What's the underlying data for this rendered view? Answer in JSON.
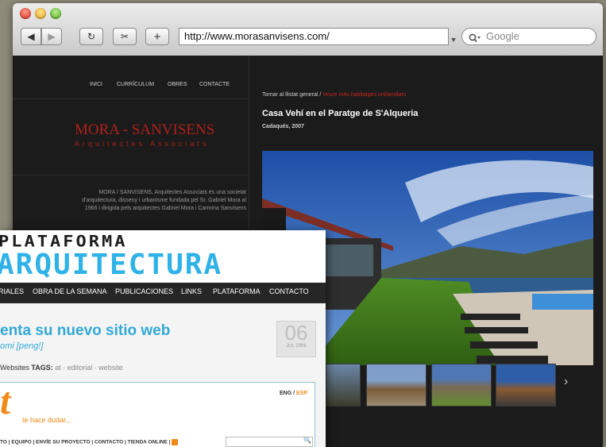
{
  "browser": {
    "url": "http://www.morasanvisens.com/",
    "search_placeholder": "Google",
    "buttons": {
      "back": "◀",
      "forward": "▶",
      "reload": "↻",
      "snip": "✂",
      "add": "+"
    }
  },
  "site": {
    "nav": [
      "INICI",
      "CURRÍCULUM",
      "OBRES",
      "CONTACTE"
    ],
    "brand": "MORA - SANVISENS",
    "brand_sub": "Arquitectes Associats",
    "intro": "MORA / SANVISENS, Arquitectes Associats és una societat d'arquitectura, disseny i urbanisme fundada pel Sr. Gabriel Mora al 1966 i dirigida pels arquitectes Gabriel Mora i Carmina Sanvisens",
    "breadcrumb_back": "Tornar al llistat general /",
    "breadcrumb_current": "Veure més habitatges unifamiliars",
    "project_title": "Casa Vehí en el Paratge de S'Alqueria",
    "project_sub": "Cadaqués, 2007",
    "thumb_next": "›"
  },
  "plataforma": {
    "logo_top": "PLATAFORMA",
    "logo_bottom": "ARQUITECTURA",
    "nav": [
      "RIALES",
      "OBRA DE LA SEMANA",
      "PUBLICACIONES",
      "LINKS",
      "PLATAFORMA",
      "CONTACTO"
    ],
    "headline": "enta su nuevo sitio web",
    "author": "omi [peng!]",
    "tags_prefix": "Websites",
    "tags_label": "TAGS:",
    "tags_values": "at · editorial · website",
    "date_day": "06",
    "date_month": "JUL 2008",
    "card_letter": "t",
    "card_tagline": "te hace dudar...",
    "lang_eng": "ENG /",
    "lang_esp": "ESP",
    "bottom_nav": "TO  |  EQUIPO  |  ENVÍE SU PROYECTO  |  CONTACTO  |  TIENDA ONLINE  |",
    "search_icon_glyph": "🔍"
  }
}
